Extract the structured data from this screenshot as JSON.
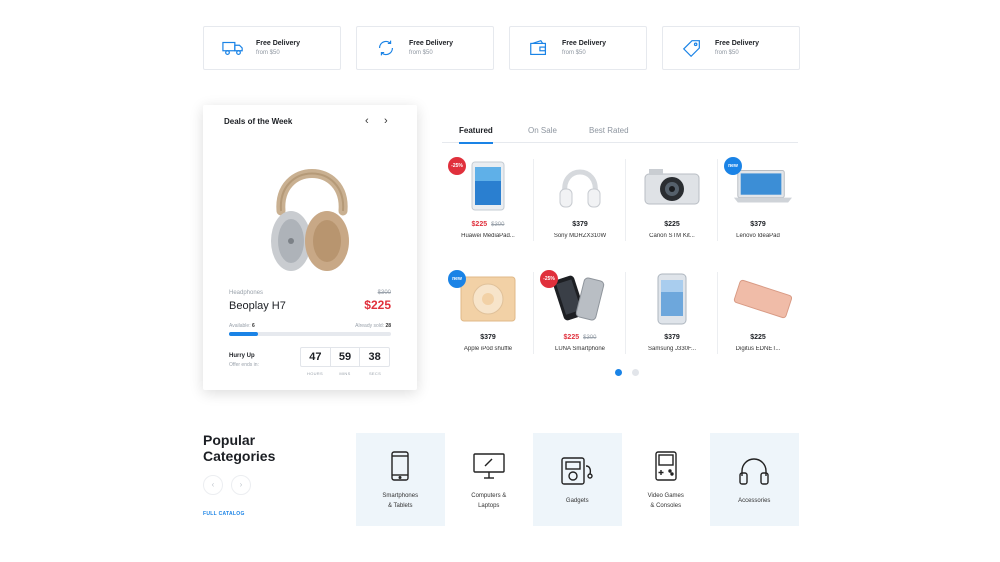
{
  "features": [
    {
      "icon": "truck-icon",
      "title": "Free Delivery",
      "subtitle": "from $50"
    },
    {
      "icon": "refresh-icon",
      "title": "Free Delivery",
      "subtitle": "from $50"
    },
    {
      "icon": "wallet-icon",
      "title": "Free Delivery",
      "subtitle": "from $50"
    },
    {
      "icon": "tag-icon",
      "title": "Free Delivery",
      "subtitle": "from $50"
    }
  ],
  "deal": {
    "title": "Deals of the Week",
    "prev": "‹",
    "next": "›",
    "category": "Headphones",
    "old_price": "$300",
    "name": "Beoplay H7",
    "price": "$225",
    "available_label": "Available:",
    "available": "6",
    "sold_label": "Already sold:",
    "sold": "28",
    "progress": 0.18,
    "hurry": "Hurry Up",
    "offer": "Offer ends in:",
    "timer": {
      "hours": "47",
      "mins": "59",
      "secs": "38"
    },
    "timer_labels": {
      "hours": "HOURS",
      "mins": "MINS",
      "secs": "SECS"
    }
  },
  "tabs": [
    {
      "label": "Featured",
      "active": true
    },
    {
      "label": "On Sale",
      "active": false
    },
    {
      "label": "Best Rated",
      "active": false
    }
  ],
  "products": [
    {
      "name": "Huawei MediaPad...",
      "price": "$225",
      "old_price": "$300",
      "badge": "-25%",
      "badge_color": "#e0303c",
      "image": "tablet"
    },
    {
      "name": "Sony MDRZX310W",
      "price": "$379",
      "old_price": "",
      "badge": "",
      "image": "headphones"
    },
    {
      "name": "Canon STM Kit...",
      "price": "$225",
      "old_price": "",
      "badge": "",
      "image": "camera"
    },
    {
      "name": "Lenovo IdeaPad",
      "price": "$379",
      "old_price": "",
      "badge": "new",
      "badge_color": "#1a83e6",
      "image": "laptop"
    },
    {
      "name": "Apple iPod shuffle",
      "price": "$379",
      "old_price": "",
      "badge": "new",
      "badge_color": "#1a83e6",
      "image": "ipod"
    },
    {
      "name": "LUNA Smartphone",
      "price": "$225",
      "old_price": "$300",
      "badge": "-25%",
      "badge_color": "#e0303c",
      "image": "phones"
    },
    {
      "name": "Samsung J330F...",
      "price": "$379",
      "old_price": "",
      "badge": "",
      "image": "samsung"
    },
    {
      "name": "Digitus EDNET...",
      "price": "$225",
      "old_price": "",
      "badge": "",
      "image": "powerbank"
    }
  ],
  "pagination": {
    "pages": 2,
    "active": 0
  },
  "popular": {
    "title": "Popular Categories",
    "prev": "‹",
    "next": "›",
    "link": "FULL CATALOG",
    "categories": [
      {
        "label": "Smartphones\n& Tablets",
        "icon": "smartphone-icon",
        "shaded": true
      },
      {
        "label": "Computers &\nLaptops",
        "icon": "monitor-icon",
        "shaded": false
      },
      {
        "label": "Gadgets",
        "icon": "media-player-icon",
        "shaded": true
      },
      {
        "label": "Video Games\n& Consoles",
        "icon": "gameboy-icon",
        "shaded": false
      },
      {
        "label": "Accessories",
        "icon": "headphones-icon",
        "shaded": true
      }
    ]
  },
  "colors": {
    "accent": "#1a83e6",
    "sale": "#e0303c",
    "category_bg": "#eef5fa"
  }
}
